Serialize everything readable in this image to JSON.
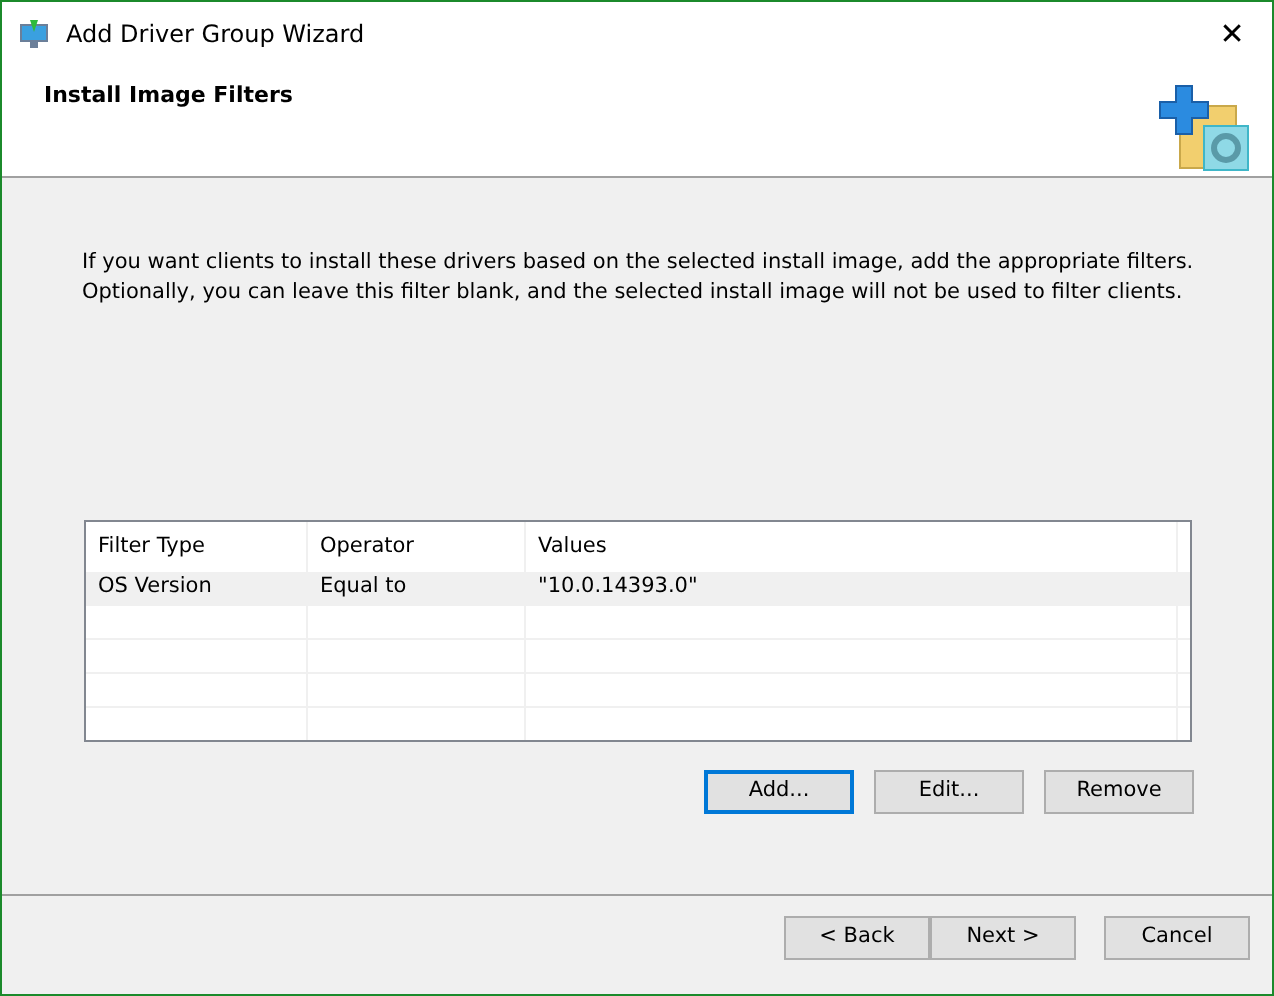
{
  "window": {
    "title": "Add Driver Group Wizard",
    "close": "✕"
  },
  "header": {
    "title": "Install Image Filters"
  },
  "description": "If you want clients to install these drivers based on the selected install image, add the appropriate filters. Optionally, you can leave this filter blank, and the selected install image will not be used to filter clients.",
  "table": {
    "columns": [
      "Filter Type",
      "Operator",
      "Values"
    ],
    "rows": [
      {
        "cells": [
          "OS Version",
          "Equal to",
          "\"10.0.14393.0\""
        ],
        "selected": true
      }
    ]
  },
  "filter_buttons": [
    {
      "label": "Add...",
      "default": true
    },
    {
      "label": "Edit...",
      "default": false
    },
    {
      "label": "Remove",
      "default": false
    }
  ],
  "nav_buttons": [
    {
      "label": "< Back",
      "default": false
    },
    {
      "label": "Next >",
      "default": false
    },
    {
      "label": "Cancel",
      "default": false
    }
  ]
}
